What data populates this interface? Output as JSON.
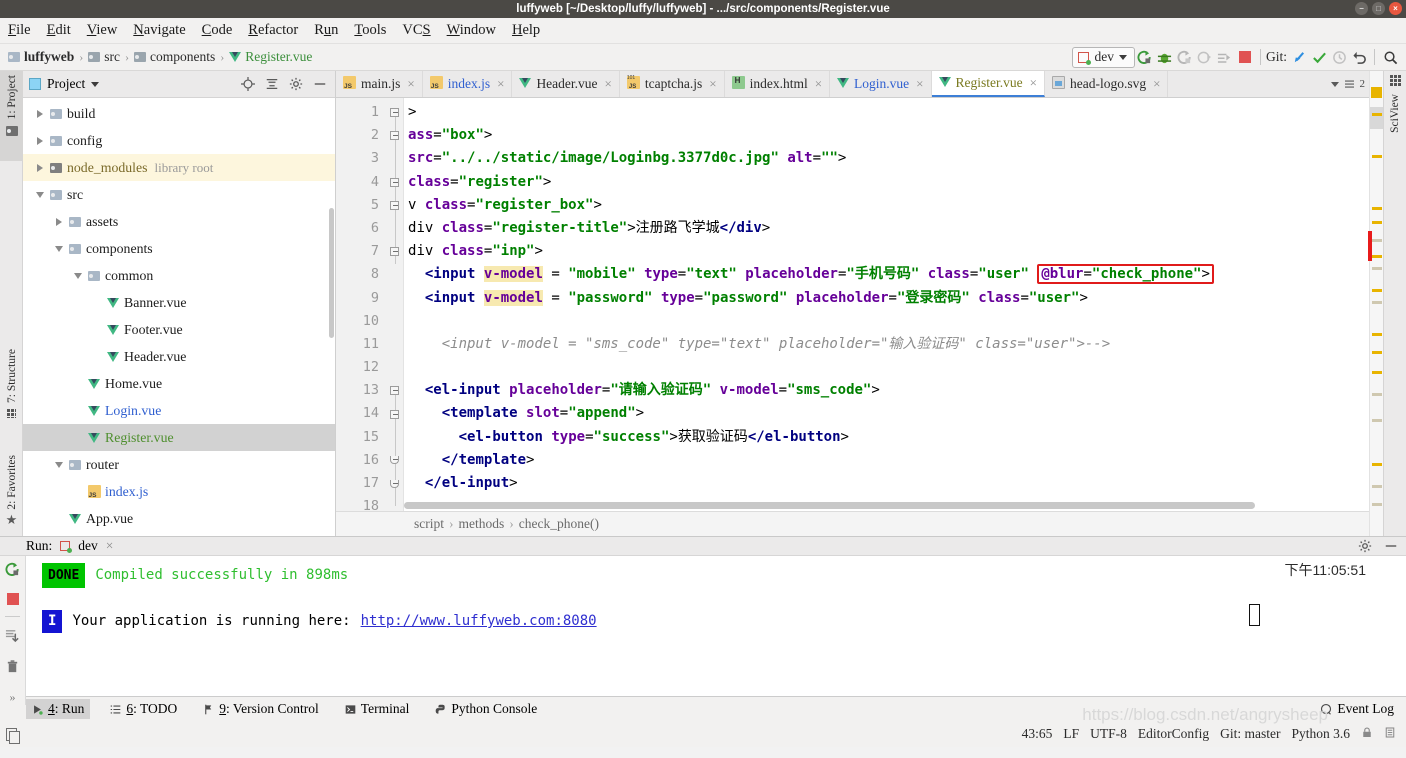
{
  "window": {
    "title": "luffyweb [~/Desktop/luffy/luffyweb] - .../src/components/Register.vue",
    "minimize": "−",
    "maximize": "□",
    "close": "×"
  },
  "menubar": {
    "items": [
      "File",
      "Edit",
      "View",
      "Navigate",
      "Code",
      "Refactor",
      "Run",
      "Tools",
      "VCS",
      "Window",
      "Help"
    ]
  },
  "navbar": {
    "breadcrumbs": [
      "luffyweb",
      "src",
      "components",
      "Register.vue"
    ],
    "separator": "›",
    "run_config": "dev",
    "git_label": "Git:",
    "icons": [
      "run-icon",
      "debug-icon",
      "run-with-coverage-icon",
      "profile-icon",
      "run-anything-icon",
      "stop-icon",
      "git-update-icon",
      "git-commit-icon",
      "git-history-icon",
      "git-rollback-icon",
      "search-everywhere-icon"
    ]
  },
  "left_tool_tabs": [
    "1: Project",
    "7: Structure",
    "2: Favorites"
  ],
  "right_tool_tabs": [
    "SciView"
  ],
  "project_panel": {
    "title": "Project",
    "header_icons": [
      "locate-icon",
      "collapse-all-icon",
      "settings-icon",
      "hide-icon"
    ],
    "tree": [
      {
        "label": "build",
        "indent": 1,
        "state": "collapsed",
        "icon": "folder-icon",
        "color": "dark"
      },
      {
        "label": "config",
        "indent": 1,
        "state": "collapsed",
        "icon": "folder-icon",
        "color": "dark"
      },
      {
        "label": "node_modules",
        "sub": "library root",
        "indent": 1,
        "state": "collapsed",
        "icon": "folder-lib-icon",
        "color": "brown",
        "highlight": "yellow"
      },
      {
        "label": "src",
        "indent": 1,
        "state": "expanded",
        "icon": "folder-icon",
        "color": "dark"
      },
      {
        "label": "assets",
        "indent": 2,
        "state": "collapsed",
        "icon": "folder-icon",
        "color": "dark"
      },
      {
        "label": "components",
        "indent": 2,
        "state": "expanded",
        "icon": "folder-icon",
        "color": "dark"
      },
      {
        "label": "common",
        "indent": 3,
        "state": "expanded",
        "icon": "folder-icon",
        "color": "dark"
      },
      {
        "label": "Banner.vue",
        "indent": 4,
        "state": "leaf",
        "icon": "vue-icon",
        "color": "dark"
      },
      {
        "label": "Footer.vue",
        "indent": 4,
        "state": "leaf",
        "icon": "vue-icon",
        "color": "dark"
      },
      {
        "label": "Header.vue",
        "indent": 4,
        "state": "leaf",
        "icon": "vue-icon",
        "color": "dark"
      },
      {
        "label": "Home.vue",
        "indent": 3,
        "state": "leaf",
        "icon": "vue-icon",
        "color": "dark"
      },
      {
        "label": "Login.vue",
        "indent": 3,
        "state": "leaf",
        "icon": "vue-icon",
        "color": "blue"
      },
      {
        "label": "Register.vue",
        "indent": 3,
        "state": "leaf",
        "icon": "vue-icon",
        "color": "green",
        "highlight": "grey"
      },
      {
        "label": "router",
        "indent": 2,
        "state": "expanded",
        "icon": "folder-icon",
        "color": "dark"
      },
      {
        "label": "index.js",
        "indent": 3,
        "state": "leaf",
        "icon": "js-icon",
        "color": "blue"
      },
      {
        "label": "App.vue",
        "indent": 2,
        "state": "leaf",
        "icon": "vue-icon",
        "color": "dark"
      }
    ]
  },
  "editor_tabs": [
    {
      "label": "main.js",
      "icon": "js-icon",
      "color": "dark",
      "active": false
    },
    {
      "label": "index.js",
      "icon": "js-icon",
      "color": "blue",
      "active": false
    },
    {
      "label": "Header.vue",
      "icon": "vue-icon",
      "color": "dark",
      "active": false
    },
    {
      "label": "tcaptcha.js",
      "icon": "js101-icon",
      "color": "dark",
      "active": false
    },
    {
      "label": "index.html",
      "icon": "html-icon",
      "color": "dark",
      "active": false
    },
    {
      "label": "Login.vue",
      "icon": "vue-icon",
      "color": "blue",
      "active": false
    },
    {
      "label": "Register.vue",
      "icon": "vue-icon",
      "color": "olive",
      "active": true
    },
    {
      "label": "head-logo.svg",
      "icon": "svg-icon",
      "color": "dark",
      "active": false
    }
  ],
  "editor_tabs_overflow": "2",
  "editor": {
    "line_numbers": [
      1,
      2,
      3,
      4,
      5,
      6,
      7,
      8,
      9,
      10,
      11,
      12,
      13,
      14,
      15,
      16,
      17,
      18
    ],
    "lines": [
      ">",
      "ass=\"box\">",
      "src=\"../../static/image/Loginbg.3377d0c.jpg\" alt=\"\">",
      "class=\"register\">",
      "v class=\"register_box\">",
      "div class=\"register-title\">注册路飞学城</div>",
      "div class=\"inp\">",
      "  <input v-model = \"mobile\" type=\"text\" placeholder=\"手机号码\" class=\"user\" @blur=\"check_phone\">",
      "  <input v-model = \"password\" type=\"password\" placeholder=\"登录密码\" class=\"user\">",
      "",
      "    <input v-model = \"sms_code\" type=\"text\" placeholder=\"输入验证码\" class=\"user\">-->",
      "",
      "  <el-input placeholder=\"请输入验证码\" v-model=\"sms_code\">",
      "    <template slot=\"append\">",
      "      <el-button type=\"success\">获取验证码</el-button>",
      "    </template>",
      "  </el-input>",
      ""
    ],
    "annotation": "@blur=\"check_phone\">",
    "breadcrumb": [
      "script",
      "methods",
      "check_phone()"
    ],
    "breadcrumb_sep": "›"
  },
  "run_panel": {
    "title": "Run:",
    "tab": "dev",
    "tab_close": "×",
    "done_badge": "DONE",
    "compiled_msg": "Compiled successfully in 898ms",
    "info_badge": "I",
    "running_msg": "Your application is running here:",
    "url": "http://www.luffyweb.com:8080",
    "timestamp": "下午11:05:51",
    "tool_icons": [
      "rerun-icon",
      "stop-icon",
      "scroll-to-end-icon",
      "trash-icon",
      "more-icon"
    ]
  },
  "tool_window_bar": {
    "items": [
      {
        "num": "4",
        "label": ": Run",
        "icon": "run-icon",
        "active": true
      },
      {
        "num": "6",
        "label": ": TODO",
        "icon": "todo-icon",
        "active": false
      },
      {
        "num": "9",
        "label": ": Version Control",
        "icon": "vcs-icon",
        "active": false
      },
      {
        "num": "",
        "label": "Terminal",
        "icon": "terminal-icon",
        "active": false
      },
      {
        "num": "",
        "label": "Python Console",
        "icon": "python-icon",
        "active": false
      }
    ],
    "event_log": "Event Log"
  },
  "statusbar": {
    "caret": "43:65",
    "line_sep": "LF",
    "encoding": "UTF-8",
    "editorconfig": "EditorConfig",
    "git_branch": "Git: master",
    "interpreter": "Python 3.6",
    "watermark": "https://blog.csdn.net/angrysheep"
  },
  "colors": {
    "accent_blue": "#3d7fd6",
    "vue_green": "#41b883",
    "done_green": "#00c400",
    "annotation_red": "#e01b1b",
    "link_blue": "#2f2fd0"
  }
}
